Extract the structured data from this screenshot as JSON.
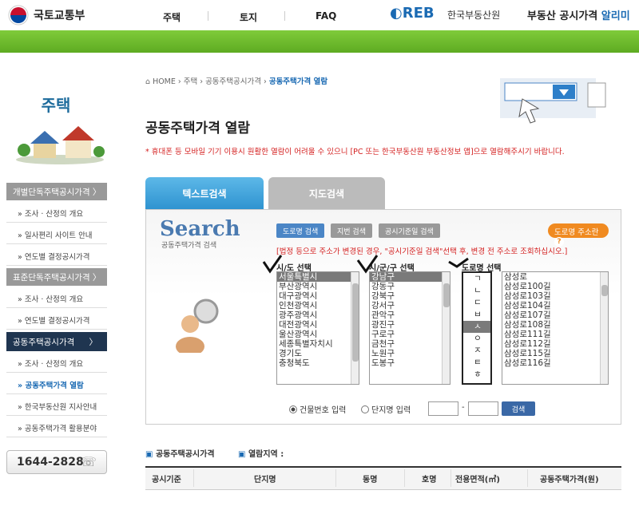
{
  "header": {
    "ministry": "국토교통부",
    "nav": [
      "주택",
      "토지",
      "FAQ"
    ],
    "reb_logo": "REB",
    "reb_org": "한국부동산원",
    "reb_title_a": "부동산 공시가격",
    "reb_title_b": "알리미"
  },
  "sidebar": {
    "title": "주택",
    "sections": [
      {
        "head": "개별단독주택공시가격  〉",
        "items": [
          "조사 · 산정의 개요",
          "일사편리 사이트 안내",
          "연도별 결정공시가격"
        ]
      },
      {
        "head": "표준단독주택공시가격  〉",
        "items": [
          "조사 · 산정의 개요",
          "연도별 결정공시가격"
        ]
      },
      {
        "head": "공동주택공시가격",
        "items": [
          "조사 · 산정의 개요",
          "공동주택가격 열람",
          "한국부동산원 지사안내",
          "공동주택가격 활용분야"
        ]
      }
    ],
    "phone": "1644-2828"
  },
  "breadcrumb": [
    "HOME",
    "주택",
    "공동주택공시가격",
    "공동주택가격 열람"
  ],
  "page_title": "공동주택가격 열람",
  "notice": "* 휴대폰 등 모바일 기기 이용시 원활한 열람이 어려울 수 있으니 [PC 또는 한국부동산원 부동산정보 앱]으로 열람해주시기 바랍니다.",
  "tabs": [
    "텍스트검색",
    "지도검색"
  ],
  "search": {
    "logo": "Search",
    "sub": "공동주택가격 검색",
    "mode_buttons": [
      "도로명 검색",
      "지번 검색",
      "공시기준일 검색"
    ],
    "road_help": "도로명 주소란",
    "instruction": "[법정 등으로 주소가 변경된 경우, \"공시기준일 검색\"선택 후, 변경 전 주소로 조회하십시오.]",
    "col_sido": "시/도 선택",
    "col_sigungu": "시/군/구 선택",
    "col_road": "도로명 선택",
    "sido": [
      "서울특별시",
      "부산광역시",
      "대구광역시",
      "인천광역시",
      "광주광역시",
      "대전광역시",
      "울산광역시",
      "세종특별자치시",
      "경기도",
      "충청북도"
    ],
    "sigungu": [
      "강남구",
      "강동구",
      "강북구",
      "강서구",
      "관악구",
      "광진구",
      "구로구",
      "금천구",
      "노원구",
      "도봉구"
    ],
    "initials": [
      "ㄱ",
      "ㄴ",
      "ㄷ",
      "ㅂ",
      "ㅅ",
      "ㅇ",
      "ㅈ",
      "ㅌ",
      "ㅎ"
    ],
    "roads": [
      "삼성로",
      "삼성로100길",
      "삼성로103길",
      "삼성로104길",
      "삼성로107길",
      "삼성로108길",
      "삼성로111길",
      "삼성로112길",
      "삼성로115길",
      "삼성로116길"
    ],
    "radio_building": "건물번호 입력",
    "radio_complex": "단지명 입력",
    "dash": "-",
    "search_btn": "검색"
  },
  "results": {
    "section_a": "공동주택공시가격",
    "section_b": "열람지역 :",
    "columns": [
      "공시기준",
      "단지명",
      "동명",
      "호명",
      "전용면적(㎡)",
      "공동주택가격(원)"
    ]
  }
}
